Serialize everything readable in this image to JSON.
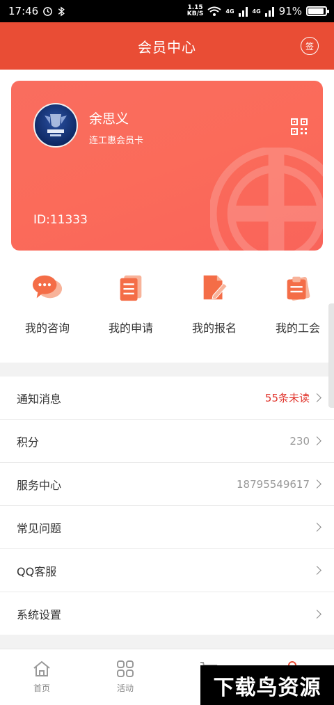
{
  "statusbar": {
    "time": "17:46",
    "net_speed_top": "1.15",
    "net_speed_bottom": "KB/S",
    "signal_4g_1": "4G",
    "signal_4g_2": "4G",
    "battery": "91%",
    "battery_level": 0.91
  },
  "header": {
    "title": "会员中心",
    "sign_label": "签"
  },
  "card": {
    "name": "余思义",
    "type": "连工惠会员卡",
    "id": "ID:11333",
    "icons": {
      "avatar": "avatar-image",
      "qr": "qr-code-icon"
    }
  },
  "quick_actions": [
    {
      "label": "我的咨询",
      "icon": "chat-bubbles-icon"
    },
    {
      "label": "我的申请",
      "icon": "document-stack-icon"
    },
    {
      "label": "我的报名",
      "icon": "edit-document-icon"
    },
    {
      "label": "我的工会",
      "icon": "clipboard-icon"
    }
  ],
  "menu": [
    {
      "label": "通知消息",
      "value": "55条未读",
      "value_highlight": true
    },
    {
      "label": "积分",
      "value": "230"
    },
    {
      "label": "服务中心",
      "value": "18795549617"
    },
    {
      "label": "常见问题",
      "value": ""
    },
    {
      "label": "QQ客服",
      "value": ""
    },
    {
      "label": "系统设置",
      "value": ""
    }
  ],
  "tabbar": [
    {
      "label": "首页",
      "icon": "home-icon"
    },
    {
      "label": "活动",
      "icon": "grid-icon"
    },
    {
      "label": "",
      "icon": "cart-icon"
    },
    {
      "label": "",
      "icon": "user-icon"
    }
  ],
  "watermark": "下载鸟资源",
  "colors": {
    "brand": "#e94d35",
    "card": "#fb6b5a",
    "highlight": "#e0322a"
  }
}
